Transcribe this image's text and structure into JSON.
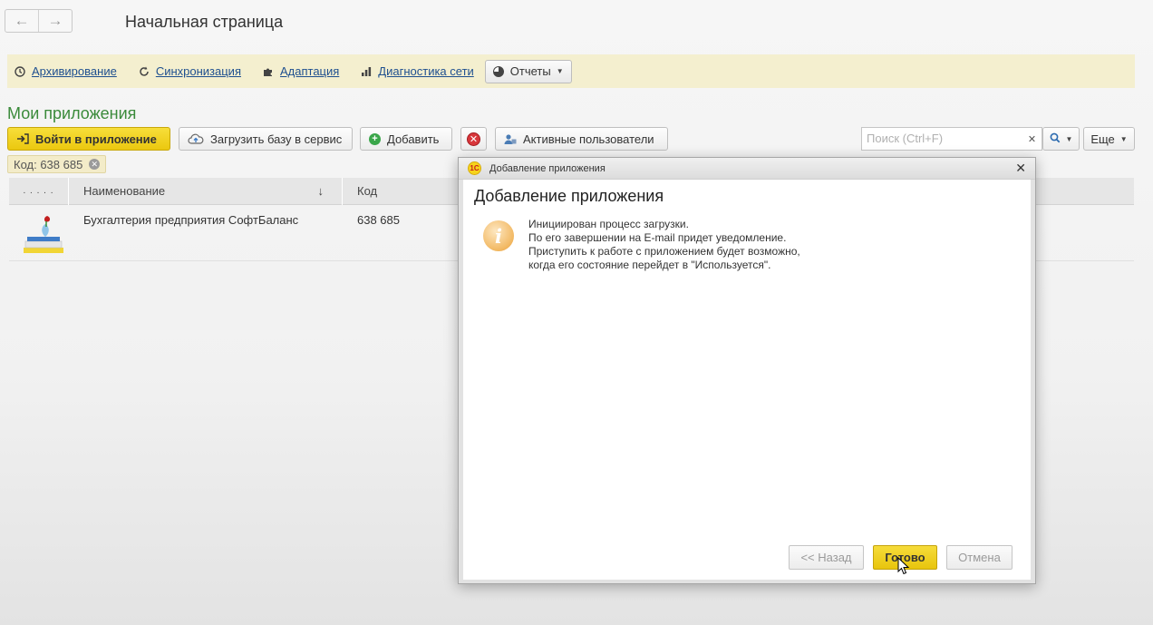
{
  "header": {
    "title": "Начальная страница",
    "back_icon": "arrow-left-icon",
    "forward_icon": "arrow-right-icon"
  },
  "command_bar": {
    "items": [
      {
        "label": "Архивирование",
        "icon": "clock-icon"
      },
      {
        "label": "Синхронизация",
        "icon": "refresh-icon"
      },
      {
        "label": "Адаптация",
        "icon": "puzzle-icon"
      },
      {
        "label": "Диагностика сети",
        "icon": "bar-chart-icon"
      }
    ],
    "reports_label": "Отчеты"
  },
  "section": {
    "title": "Мои приложения"
  },
  "toolbar": {
    "enter_label": "Войти в приложение",
    "upload_label": "Загрузить базу в сервис",
    "add_label": "Добавить",
    "active_users_label": "Активные пользователи",
    "search_placeholder": "Поиск (Ctrl+F)",
    "more_label": "Еще"
  },
  "filter": {
    "label": "Код: 638 685"
  },
  "table": {
    "columns": [
      ". . . . .",
      "Наименование",
      "Код"
    ],
    "sort_indicator": "↓",
    "rows": [
      {
        "name": "Бухгалтерия предприятия СофтБаланс",
        "code": "638 685"
      }
    ]
  },
  "dialog": {
    "window_title": "Добавление приложения",
    "heading": "Добавление приложения",
    "message_lines": [
      "Инициирован процесс загрузки.",
      "По его завершении на E-mail придет уведомление.",
      "Приступить к работе с приложением будет возможно,",
      "когда его состояние перейдет в \"Используется\"."
    ],
    "back_label": "<< Назад",
    "done_label": "Готово",
    "cancel_label": "Отмена",
    "logo_text": "1С"
  },
  "colors": {
    "accent_yellow": "#f0d020",
    "section_green": "#3a8a3a",
    "command_bar_bg": "#f4efcf",
    "link_blue": "#1e4f8f"
  }
}
